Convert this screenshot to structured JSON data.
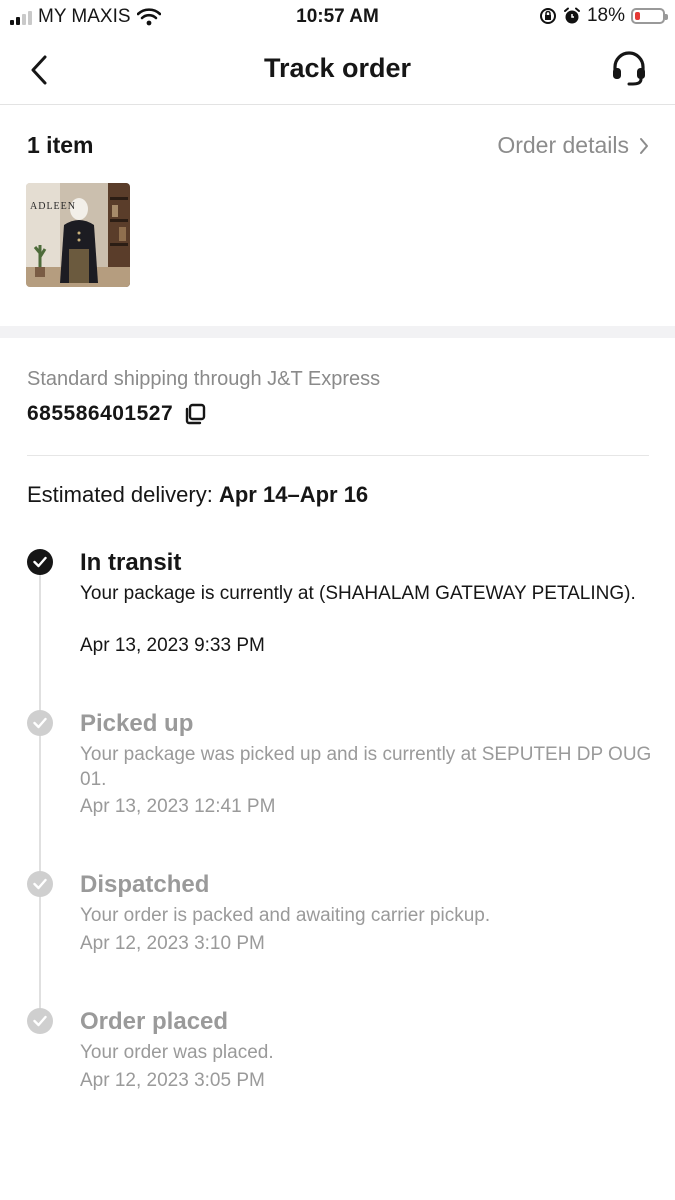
{
  "status_bar": {
    "carrier": "MY MAXIS",
    "time": "10:57 AM",
    "battery": "18%",
    "battery_level": 0.18
  },
  "nav": {
    "title": "Track order"
  },
  "items": {
    "count_label": "1 item",
    "details_link": "Order details",
    "thumbnail_brand": "ADLEEN"
  },
  "shipping": {
    "method": "Standard shipping through J&T Express",
    "tracking_number": "685586401527",
    "estimated_label": "Estimated delivery:",
    "estimated_range": "Apr 14–Apr 16"
  },
  "timeline": [
    {
      "title": "In transit",
      "description": "Your package is currently at (SHAHALAM GATEWAY PETALING).",
      "date": "Apr 13, 2023 9:33 PM",
      "state": "current"
    },
    {
      "title": "Picked up",
      "description": "Your package was picked up and is currently at SEPUTEH DP OUG 01.",
      "date": "Apr 13, 2023 12:41 PM",
      "state": "done"
    },
    {
      "title": "Dispatched",
      "description": "Your order is packed and awaiting carrier pickup.",
      "date": "Apr 12, 2023 3:10 PM",
      "state": "done"
    },
    {
      "title": "Order placed",
      "description": "Your order was placed.",
      "date": "Apr 12, 2023 3:05 PM",
      "state": "done"
    }
  ],
  "colors": {
    "text_primary": "#161616",
    "text_muted": "#9a9a9a",
    "divider": "#e3e3e3",
    "battery_low": "#e53935"
  }
}
